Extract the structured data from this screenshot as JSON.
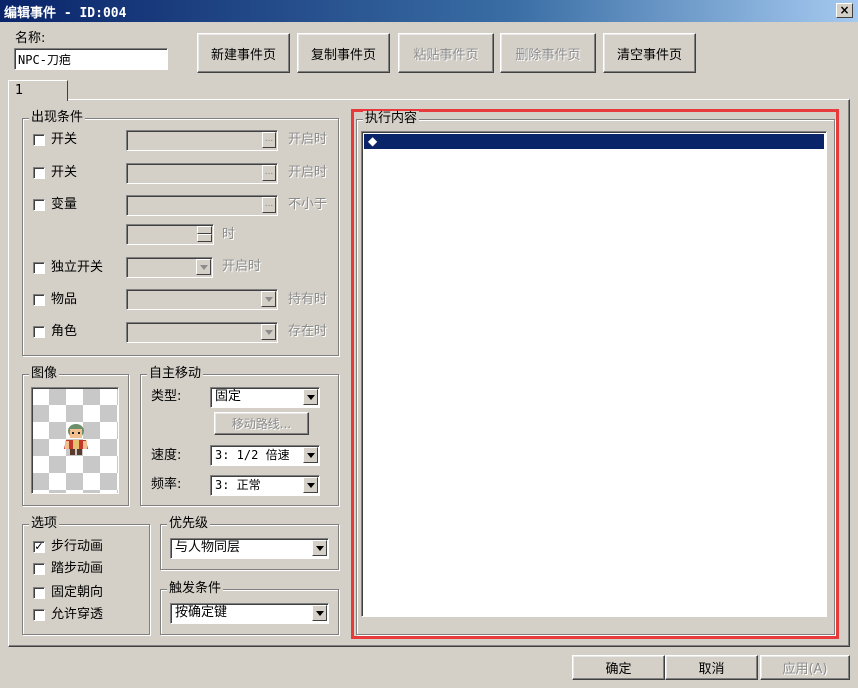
{
  "window": {
    "title": "编辑事件 - ID:004",
    "close_glyph": "×"
  },
  "name_field": {
    "label": "名称:",
    "value": "NPC-刀疤"
  },
  "toolbar": {
    "new_page": "新建事件页",
    "copy_page": "复制事件页",
    "paste_page": "粘贴事件页",
    "delete_page": "删除事件页",
    "clear_page": "清空事件页"
  },
  "tabs": [
    {
      "label": "1"
    }
  ],
  "conditions": {
    "title": "出现条件",
    "switch1": {
      "label": "开关",
      "suffix": "开启时",
      "checked": false
    },
    "switch2": {
      "label": "开关",
      "suffix": "开启时",
      "checked": false
    },
    "variable": {
      "label": "变量",
      "suffix": "不小于",
      "checked": false
    },
    "variable_value": {
      "suffix": "时"
    },
    "self_switch": {
      "label": "独立开关",
      "suffix": "开启时",
      "checked": false
    },
    "item": {
      "label": "物品",
      "suffix": "持有时",
      "checked": false
    },
    "actor": {
      "label": "角色",
      "suffix": "存在时",
      "checked": false
    },
    "ellipsis": "..."
  },
  "graphic": {
    "title": "图像",
    "sprite_icon": "character-sprite"
  },
  "autonomous_movement": {
    "title": "自主移动",
    "type_label": "类型:",
    "type_value": "固定",
    "route_button": "移动路线...",
    "speed_label": "速度:",
    "speed_value": "3: 1/2 倍速",
    "freq_label": "频率:",
    "freq_value": "3: 正常"
  },
  "options": {
    "title": "选项",
    "walk_anim": {
      "label": "步行动画",
      "checked": true,
      "mark": "✓"
    },
    "step_anim": {
      "label": "踏步动画",
      "checked": false
    },
    "direction_fix": {
      "label": "固定朝向",
      "checked": false
    },
    "through": {
      "label": "允许穿透",
      "checked": false
    }
  },
  "priority": {
    "title": "优先级",
    "value": "与人物同层"
  },
  "trigger": {
    "title": "触发条件",
    "value": "按确定键"
  },
  "contents": {
    "title": "执行内容",
    "first_line": "◆"
  },
  "footer": {
    "ok": "确定",
    "cancel": "取消",
    "apply": "应用(A)"
  },
  "colors": {
    "highlight": "#e8393b",
    "selection": "#0a246a",
    "titlebar": "#0a246a"
  }
}
